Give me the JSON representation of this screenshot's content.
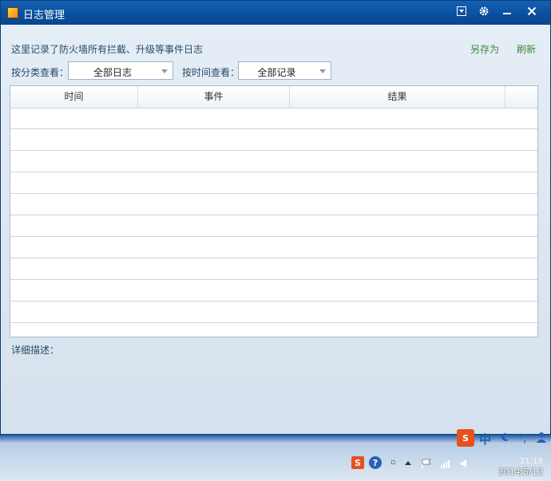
{
  "window": {
    "title": "日志管理",
    "buttons": {
      "menu": "menu",
      "settings": "settings",
      "minimize": "minimize",
      "close": "close"
    }
  },
  "toolbar": {
    "description": "这里记录了防火墙所有拦截、升级等事件日志",
    "save_as": "另存为",
    "refresh": "刷新"
  },
  "filters": {
    "category_label": "按分类查看：",
    "category_value": "全部日志",
    "time_label": "按时间查看：",
    "time_value": "全部记录"
  },
  "table": {
    "columns": [
      "时间",
      "事件",
      "结果"
    ],
    "rows": []
  },
  "detail_label": "详细描述：",
  "taskbar": {
    "ime": "中",
    "date": "2014/5/12",
    "time": "21:18"
  },
  "colors": {
    "titlebar": "#0a4f9c",
    "link": "#3b8a3b",
    "accent": "#1560b3"
  }
}
